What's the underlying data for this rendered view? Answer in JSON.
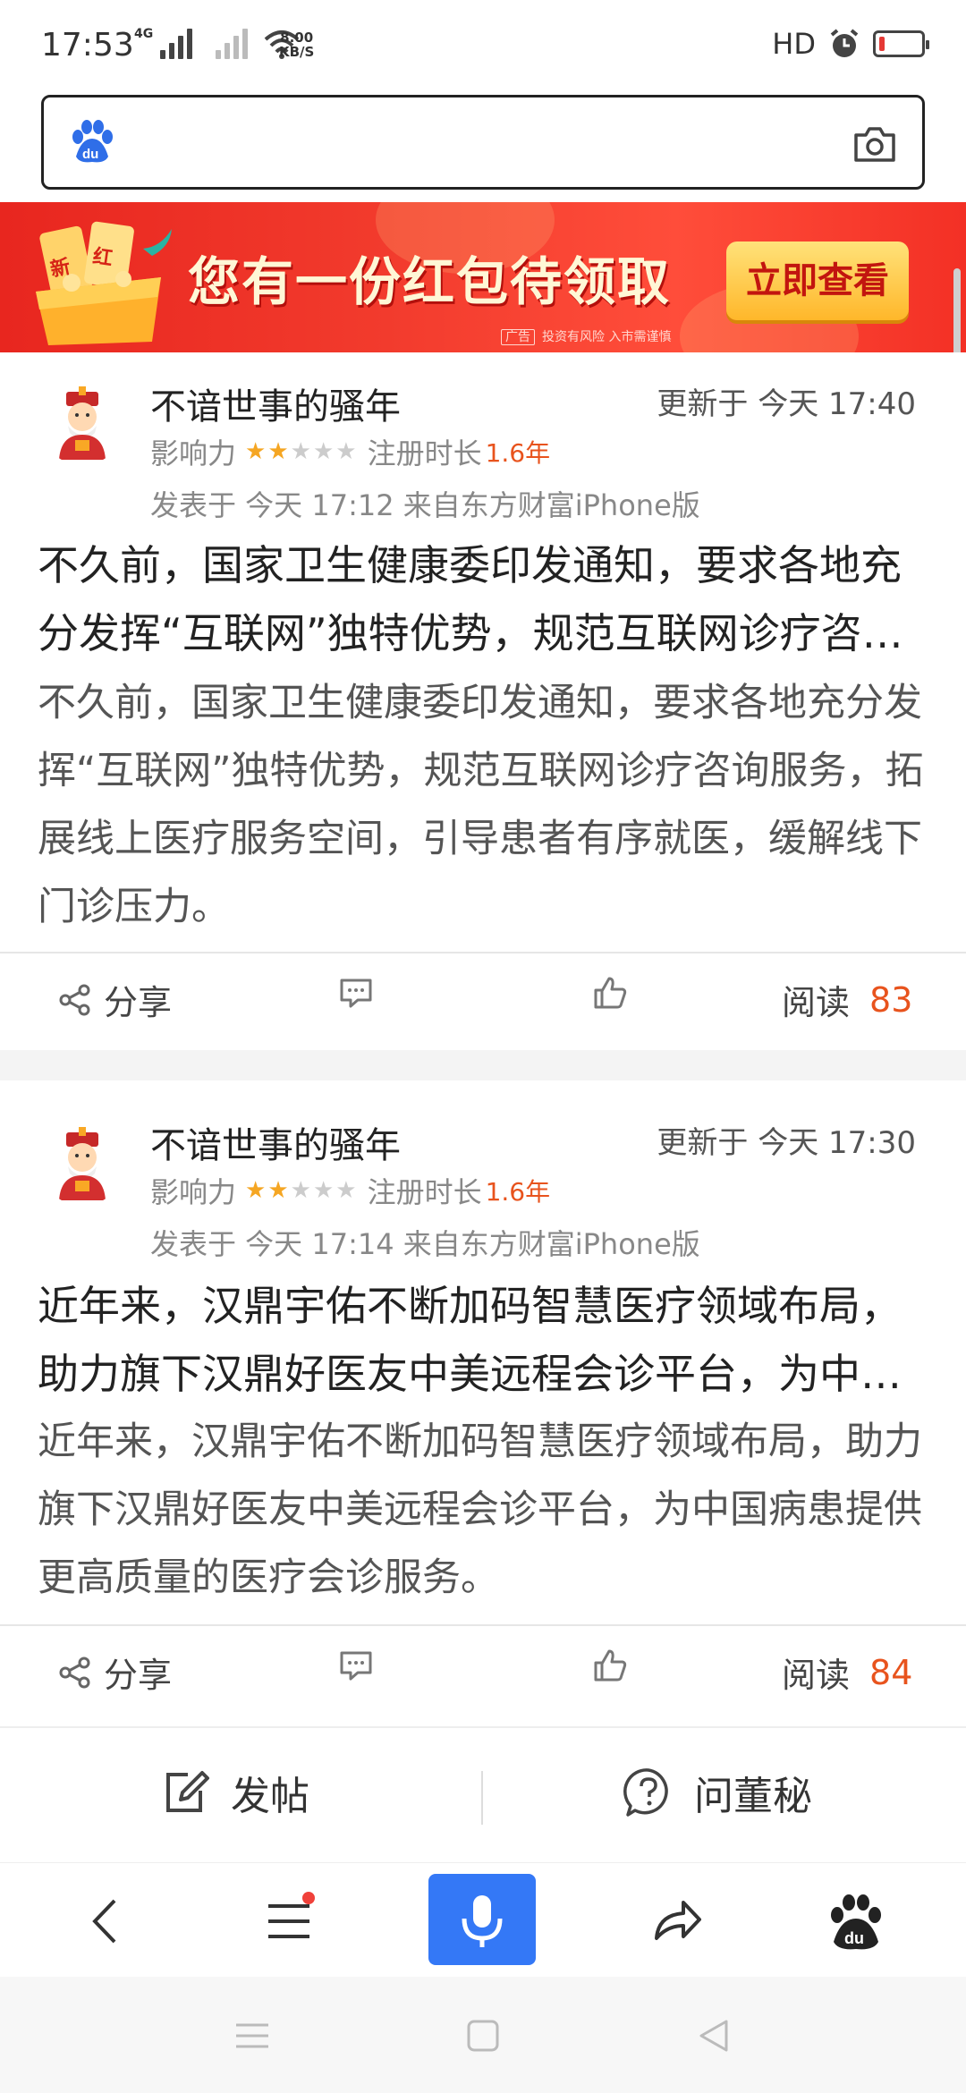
{
  "status_bar": {
    "time": "17:53",
    "net1": "4G",
    "speed_value": "8.00",
    "speed_unit": "KB/S",
    "hd": "HD"
  },
  "search": {
    "placeholder": ""
  },
  "banner": {
    "gift_tags": [
      "新",
      "红"
    ],
    "headline": "您有一份红包待领取",
    "button": "立即查看",
    "ad_label": "广告",
    "disclaimer": "投资有风险 入市需谨慎"
  },
  "posts": [
    {
      "username": "不谙世事的骚年",
      "updated": "更新于 今天 17:40",
      "influence_label": "影响力",
      "stars": 2,
      "reg_label": "注册时长",
      "reg_years": "1.6年",
      "posted": "发表于 今天 17:12  来自东方财富iPhone版",
      "title": "不久前，国家卫生健康委印发通知，要求各地充分发挥“互联网”独特优势，规范互联网诊疗咨询服务",
      "summary": "不久前，国家卫生健康委印发通知，要求各地充分发挥“互联网”独特优势，规范互联网诊疗咨询服务，拓展线上医疗服务空间，引导患者有序就医，缓解线下门诊压力。",
      "share": "分享",
      "read_label": "阅读",
      "read_count": "83"
    },
    {
      "username": "不谙世事的骚年",
      "updated": "更新于 今天 17:30",
      "influence_label": "影响力",
      "stars": 2,
      "reg_label": "注册时长",
      "reg_years": "1.6年",
      "posted": "发表于 今天 17:14  来自东方财富iPhone版",
      "title": "近年来，汉鼎宇佑不断加码智慧医疗领域布局，助力旗下汉鼎好医友中美远程会诊平台，为中国病患提供更高质量的医疗会诊服务",
      "summary": "近年来，汉鼎宇佑不断加码智慧医疗领域布局，助力旗下汉鼎好医友中美远程会诊平台，为中国病患提供更高质量的医疗会诊服务。",
      "share": "分享",
      "read_label": "阅读",
      "read_count": "84"
    }
  ],
  "post_bar": {
    "post": "发帖",
    "ask": "问董秘"
  },
  "colors": {
    "accent_blue": "#3478f6",
    "highlight_orange": "#e8531d",
    "banner_red": "#f23b2d"
  }
}
